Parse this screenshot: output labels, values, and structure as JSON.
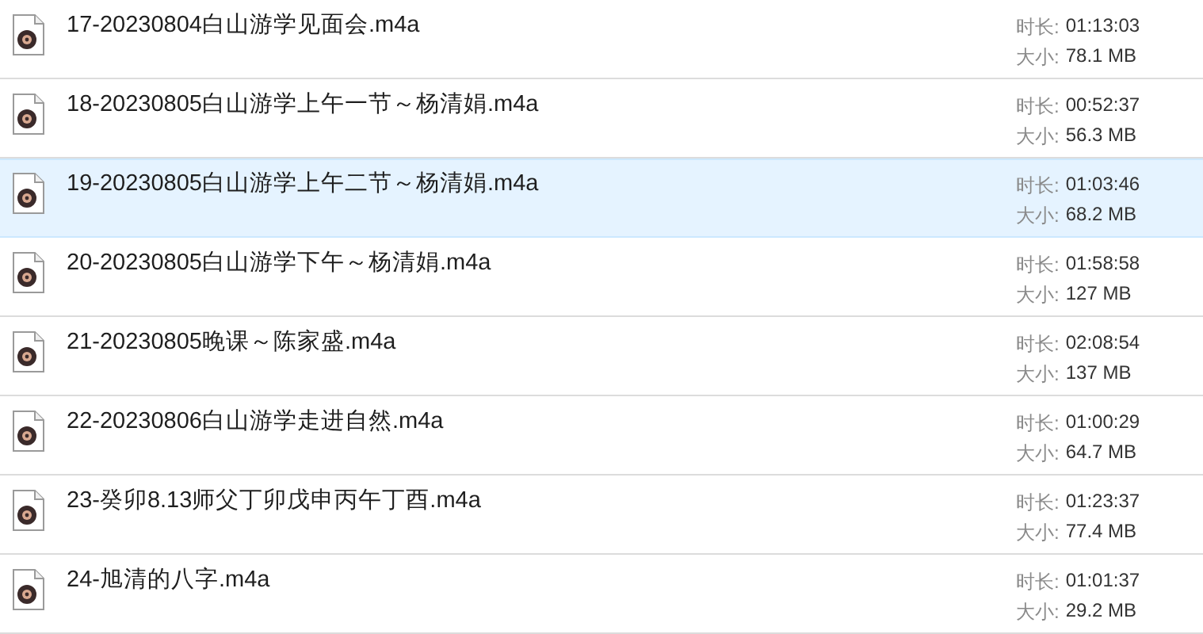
{
  "files": [
    {
      "name": "17-20230804白山游学见面会.m4a",
      "duration_label": "时长:",
      "duration": "01:13:03",
      "size_label": "大小:",
      "size": "78.1 MB",
      "selected": false
    },
    {
      "name": "18-20230805白山游学上午一节～杨清娟.m4a",
      "duration_label": "时长:",
      "duration": "00:52:37",
      "size_label": "大小:",
      "size": "56.3 MB",
      "selected": false
    },
    {
      "name": "19-20230805白山游学上午二节～杨清娟.m4a",
      "duration_label": "时长:",
      "duration": "01:03:46",
      "size_label": "大小:",
      "size": "68.2 MB",
      "selected": true
    },
    {
      "name": "20-20230805白山游学下午～杨清娟.m4a",
      "duration_label": "时长:",
      "duration": "01:58:58",
      "size_label": "大小:",
      "size": "127 MB",
      "selected": false
    },
    {
      "name": "21-20230805晚课～陈家盛.m4a",
      "duration_label": "时长:",
      "duration": "02:08:54",
      "size_label": "大小:",
      "size": "137 MB",
      "selected": false
    },
    {
      "name": "22-20230806白山游学走进自然.m4a",
      "duration_label": "时长:",
      "duration": "01:00:29",
      "size_label": "大小:",
      "size": "64.7 MB",
      "selected": false
    },
    {
      "name": "23-癸卯8.13师父丁卯戊申丙午丁酉.m4a",
      "duration_label": "时长:",
      "duration": "01:23:37",
      "size_label": "大小:",
      "size": "77.4 MB",
      "selected": false
    },
    {
      "name": "24-旭清的八字.m4a",
      "duration_label": "时长:",
      "duration": "01:01:37",
      "size_label": "大小:",
      "size": "29.2 MB",
      "selected": false
    }
  ]
}
